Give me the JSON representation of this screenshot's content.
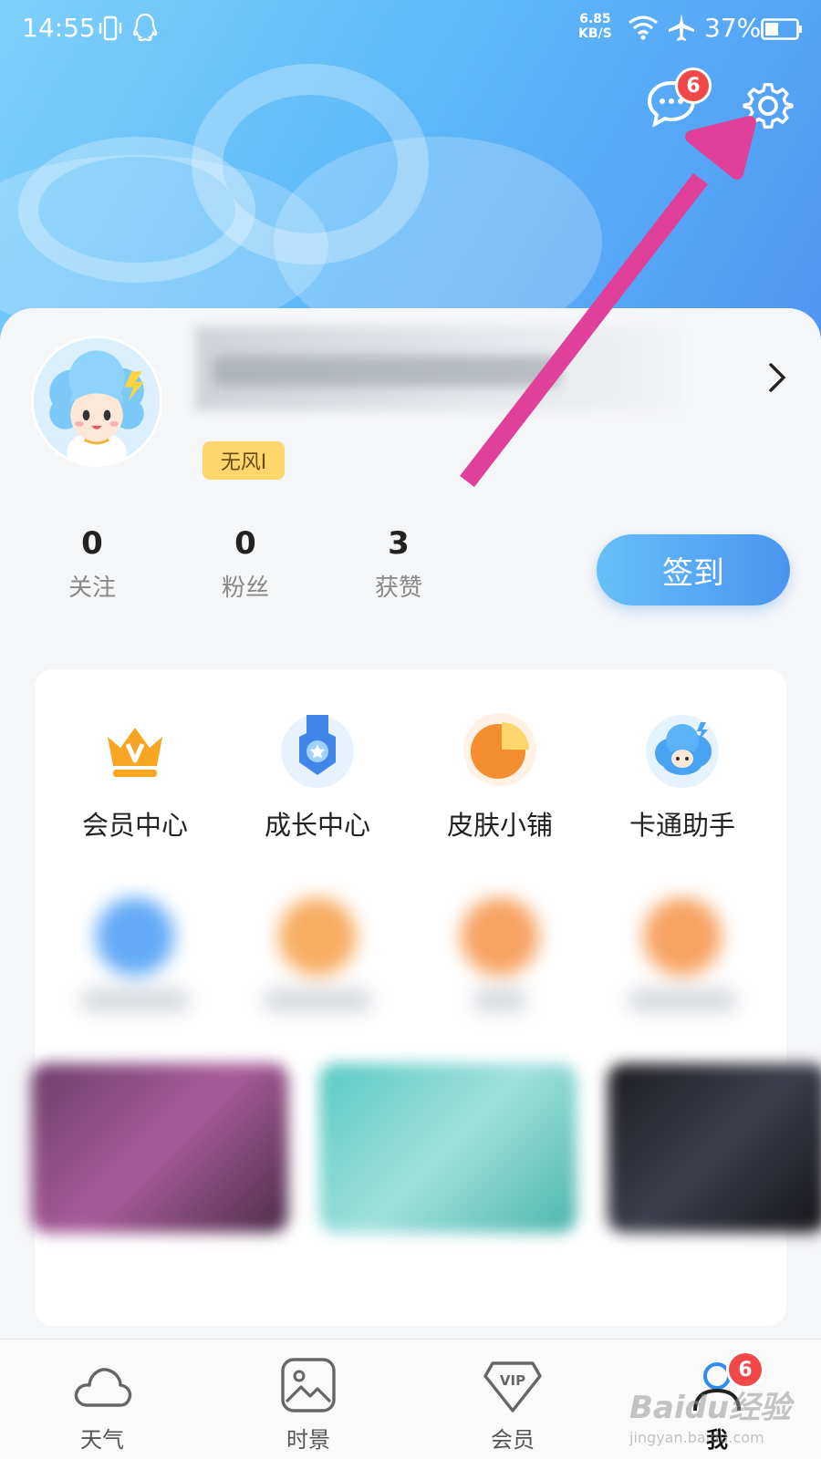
{
  "status_bar": {
    "time": "14:55",
    "net_speed_value": "6.85",
    "net_speed_unit": "KB/S",
    "battery_percent": "37%"
  },
  "header": {
    "messages_badge": "6"
  },
  "profile": {
    "level_badge": "无风I",
    "stats": [
      {
        "value": "0",
        "label": "关注"
      },
      {
        "value": "0",
        "label": "粉丝"
      },
      {
        "value": "3",
        "label": "获赞"
      }
    ],
    "checkin_label": "签到"
  },
  "services": [
    {
      "label": "会员中心",
      "icon": "crown-icon"
    },
    {
      "label": "成长中心",
      "icon": "medal-icon"
    },
    {
      "label": "皮肤小铺",
      "icon": "pie-icon"
    },
    {
      "label": "卡通助手",
      "icon": "cartoon-cloud-icon"
    }
  ],
  "bottom_nav": {
    "items": [
      {
        "label": "天气",
        "icon": "cloud-icon",
        "active": false
      },
      {
        "label": "时景",
        "icon": "picture-icon",
        "active": false
      },
      {
        "label": "会员",
        "icon": "vip-icon",
        "active": false
      },
      {
        "label": "我",
        "icon": "person-icon",
        "active": true,
        "badge": "6"
      }
    ]
  },
  "watermark": {
    "main": "Baidu经验",
    "sub": "jingyan.baidu.com"
  },
  "colors": {
    "header_start": "#7ed0fb",
    "header_end": "#4f96f3",
    "checkin_button": "#4a94f0",
    "badge_red": "#f04848",
    "level_badge": "#ffd66b",
    "annotation_arrow": "#e0409a"
  }
}
